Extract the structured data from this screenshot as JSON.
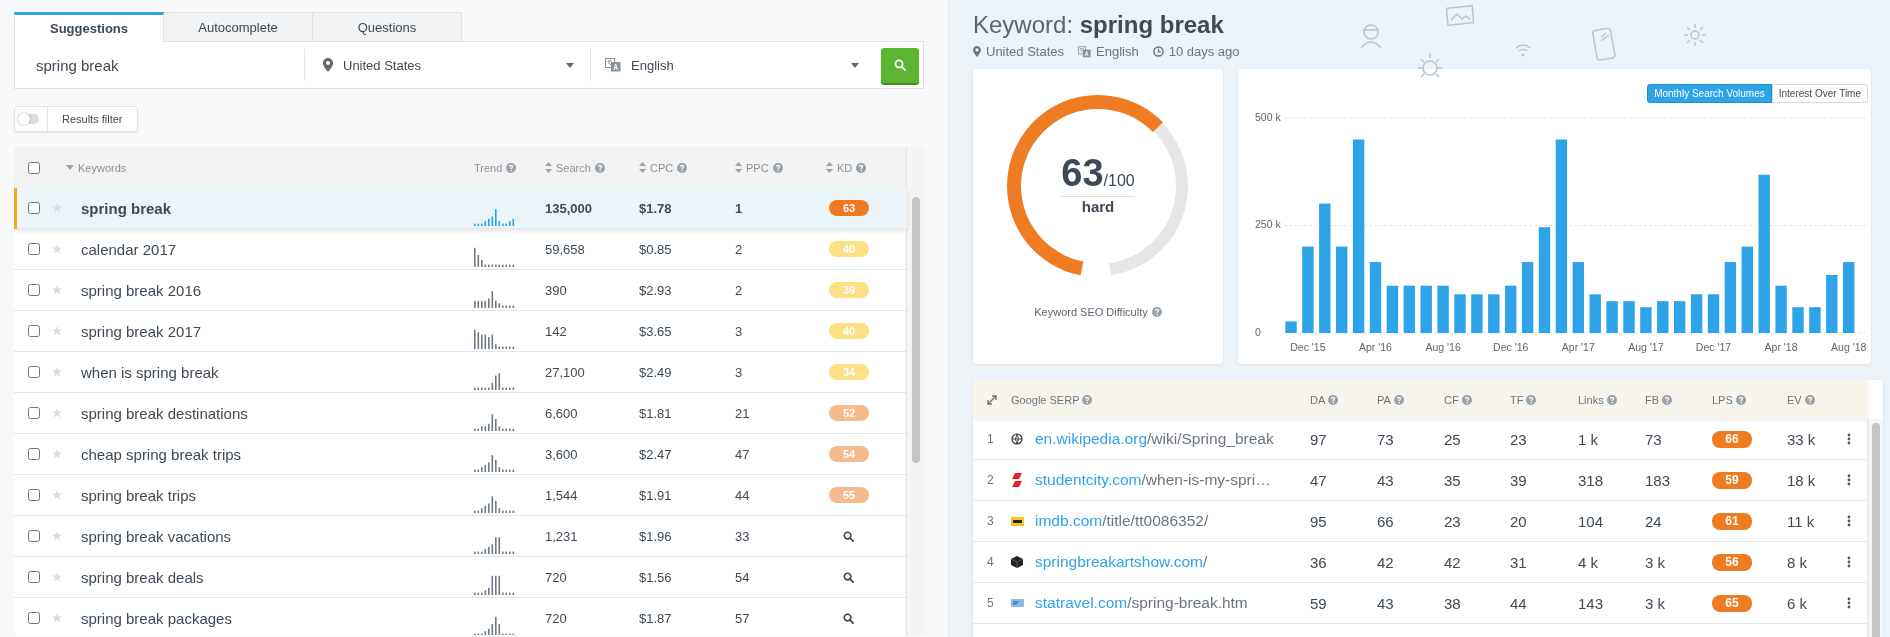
{
  "tabs": [
    {
      "label": "Suggestions",
      "selected": true
    },
    {
      "label": "Autocomplete",
      "selected": false
    },
    {
      "label": "Questions",
      "selected": false
    }
  ],
  "search": {
    "value": "spring break",
    "location": "United States",
    "language": "English"
  },
  "results_filter": {
    "label": "Results filter",
    "on": false
  },
  "keywords_table": {
    "select_all": {
      "checked": false
    },
    "columns": [
      {
        "label": "Keywords",
        "kind": "keyword"
      },
      {
        "label": "Trend",
        "kind": "trend"
      },
      {
        "label": "Search",
        "kind": "sort"
      },
      {
        "label": "CPC",
        "kind": "sort"
      },
      {
        "label": "PPC",
        "kind": "sort"
      },
      {
        "label": "KD",
        "kind": "sort"
      }
    ],
    "rows": [
      {
        "keyword": "spring break",
        "selected": true,
        "checked": false,
        "starred": false,
        "search": "135,000",
        "cpc": "$1.78",
        "ppc": "1",
        "kd": {
          "kind": "badge",
          "value": "63",
          "color": "#ee7a22"
        }
      },
      {
        "keyword": "calendar 2017",
        "selected": false,
        "checked": false,
        "starred": false,
        "search": "59,658",
        "cpc": "$0.85",
        "ppc": "2",
        "kd": {
          "kind": "badge",
          "value": "40",
          "color": "#fde084"
        }
      },
      {
        "keyword": "spring break 2016",
        "selected": false,
        "checked": false,
        "starred": false,
        "search": "390",
        "cpc": "$2.93",
        "ppc": "2",
        "kd": {
          "kind": "badge",
          "value": "39",
          "color": "#fde084"
        }
      },
      {
        "keyword": "spring break 2017",
        "selected": false,
        "checked": false,
        "starred": false,
        "search": "142",
        "cpc": "$3.65",
        "ppc": "3",
        "kd": {
          "kind": "badge",
          "value": "40",
          "color": "#fde084"
        }
      },
      {
        "keyword": "when is spring break",
        "selected": false,
        "checked": false,
        "starred": false,
        "search": "27,100",
        "cpc": "$2.49",
        "ppc": "3",
        "kd": {
          "kind": "badge",
          "value": "34",
          "color": "#fde084"
        }
      },
      {
        "keyword": "spring break destinations",
        "selected": false,
        "checked": false,
        "starred": false,
        "search": "6,600",
        "cpc": "$1.81",
        "ppc": "21",
        "kd": {
          "kind": "badge",
          "value": "52",
          "color": "#f5ba8e"
        }
      },
      {
        "keyword": "cheap spring break trips",
        "selected": false,
        "checked": false,
        "starred": false,
        "search": "3,600",
        "cpc": "$2.47",
        "ppc": "47",
        "kd": {
          "kind": "badge",
          "value": "54",
          "color": "#f5ba8e"
        }
      },
      {
        "keyword": "spring break trips",
        "selected": false,
        "checked": false,
        "starred": false,
        "search": "1,544",
        "cpc": "$1.91",
        "ppc": "44",
        "kd": {
          "kind": "badge",
          "value": "55",
          "color": "#f5ba8e"
        }
      },
      {
        "keyword": "spring break vacations",
        "selected": false,
        "checked": false,
        "starred": false,
        "search": "1,231",
        "cpc": "$1.96",
        "ppc": "33",
        "kd": {
          "kind": "lookup"
        }
      },
      {
        "keyword": "spring break deals",
        "selected": false,
        "checked": false,
        "starred": false,
        "search": "720",
        "cpc": "$1.56",
        "ppc": "54",
        "kd": {
          "kind": "lookup"
        }
      },
      {
        "keyword": "spring break packages",
        "selected": false,
        "checked": false,
        "starred": false,
        "search": "720",
        "cpc": "$1.87",
        "ppc": "57",
        "kd": {
          "kind": "lookup"
        }
      }
    ]
  },
  "detail": {
    "title": "Keyword: **spring break**",
    "location": "United States",
    "language": "English",
    "updated": "10 days ago"
  },
  "gauge": {
    "score": "63",
    "max": "/100",
    "rating": "hard",
    "level": 0.63,
    "caption": "Keyword SEO Difficulty"
  },
  "volume_chart": {
    "toggles": [
      {
        "label": "Monthly Search Volumes",
        "selected": true
      },
      {
        "label": "Interest Over Time",
        "selected": false
      }
    ],
    "chart_data": {
      "type": "bar",
      "categories": [
        null,
        "Dec '15",
        null,
        null,
        null,
        "Apr '16",
        null,
        null,
        null,
        "Aug '16",
        null,
        null,
        null,
        "Dec '16",
        null,
        null,
        null,
        "Apr '17",
        null,
        null,
        null,
        "Aug '17",
        null,
        null,
        null,
        "Dec '17",
        null,
        null,
        null,
        "Apr '18",
        null,
        null,
        null,
        "Aug '18"
      ],
      "series": [
        {
          "color": "#2ea3e8",
          "values": [
            27000,
            201000,
            301000,
            201000,
            450000,
            165000,
            110000,
            110000,
            110000,
            110000,
            90000,
            90000,
            90000,
            110000,
            165000,
            246000,
            450000,
            165000,
            90000,
            74000,
            74000,
            60000,
            74000,
            74000,
            90000,
            90000,
            165000,
            201000,
            368000,
            110000,
            60000,
            60000,
            135000,
            165000
          ]
        }
      ],
      "ylim": [
        0,
        500000
      ],
      "yticks": [
        {
          "value": 0,
          "label": "0"
        },
        {
          "value": 250000,
          "label": "250 k"
        },
        {
          "value": 500000,
          "label": "500 k"
        }
      ]
    }
  },
  "serp": {
    "title": "Google SERP",
    "columns": [
      "DA",
      "PA",
      "CF",
      "TF",
      "Links",
      "FB",
      "LPS",
      "EV"
    ],
    "rows": [
      {
        "rank": "1",
        "favicon": {
          "kind": "globe"
        },
        "domain": "en.wikipedia.org",
        "path": "/wiki/Spring_break",
        "metrics": [
          "97",
          "73",
          "25",
          "23",
          "1 k",
          "73"
        ],
        "lps": "66",
        "ev": "33 k"
      },
      {
        "rank": "2",
        "favicon": {
          "kind": "stripes"
        },
        "domain": "studentcity.com",
        "path": "/when-is-my-spri…",
        "metrics": [
          "47",
          "43",
          "35",
          "39",
          "318",
          "183"
        ],
        "lps": "59",
        "ev": "18 k"
      },
      {
        "rank": "3",
        "favicon": {
          "kind": "label"
        },
        "domain": "imdb.com",
        "path": "/title/tt0086352/",
        "metrics": [
          "95",
          "66",
          "23",
          "20",
          "104",
          "24"
        ],
        "lps": "61",
        "ev": "11 k"
      },
      {
        "rank": "4",
        "favicon": {
          "kind": "cube"
        },
        "domain": "springbreakartshow.com",
        "path": "/",
        "metrics": [
          "36",
          "42",
          "42",
          "31",
          "4 k",
          "3 k"
        ],
        "lps": "56",
        "ev": "8 k"
      },
      {
        "rank": "5",
        "favicon": {
          "kind": "card"
        },
        "domain": "statravel.com",
        "path": "/spring-break.htm",
        "metrics": [
          "59",
          "43",
          "38",
          "44",
          "143",
          "3 k"
        ],
        "lps": "65",
        "ev": "6 k"
      }
    ]
  }
}
